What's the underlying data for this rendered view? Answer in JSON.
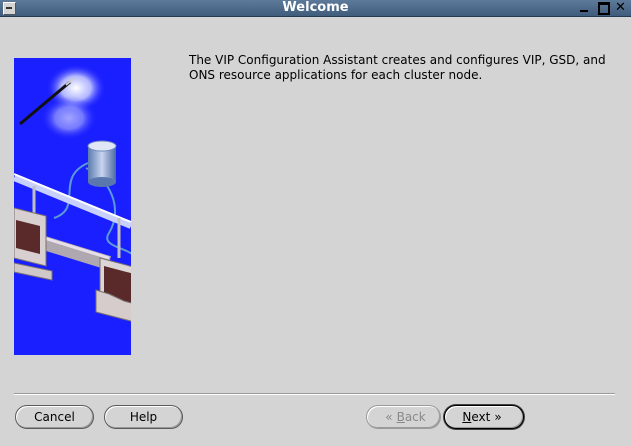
{
  "window": {
    "title": "Welcome"
  },
  "content": {
    "description": "The VIP Configuration Assistant creates and configures VIP, GSD, and ONS resource applications for each cluster node."
  },
  "buttons": {
    "cancel": "Cancel",
    "help": "Help",
    "back_mnemonic": "B",
    "back_rest": "ack",
    "next_mnemonic": "N",
    "next_rest": "ext",
    "back_chevron": "«",
    "next_chevron": "»"
  },
  "colors": {
    "titlebar": "#4a6888",
    "background": "#d4d4d4",
    "illustration_bg": "#1a1fff"
  }
}
